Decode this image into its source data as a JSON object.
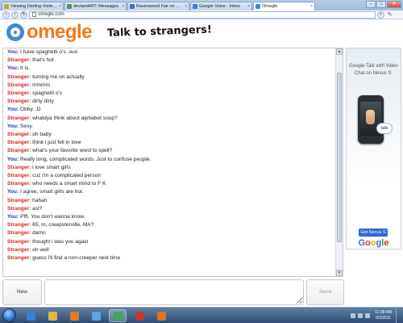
{
  "browser": {
    "tabs": [
      {
        "label": "Viewing Darling Vortexx/...",
        "favicon_color": "#c9a24d",
        "active": false
      },
      {
        "label": "deviantART: Messages",
        "favicon_color": "#5d8f55",
        "active": false
      },
      {
        "label": "Ravenwood Fair on Face...",
        "favicon_color": "#4a6db5",
        "active": false
      },
      {
        "label": "Google Voice - Inbox",
        "favicon_color": "#3a7be0",
        "active": false
      },
      {
        "label": "Omegle",
        "favicon_color": "#3b8ad8",
        "active": true
      }
    ],
    "tab_close_glyph": "×",
    "url": "omegle.com",
    "window_controls": {
      "minimize": "–",
      "maximize": "□",
      "close": "✕"
    }
  },
  "header": {
    "logo_text": "omegle",
    "tagline": "Talk to strangers!"
  },
  "chat": {
    "messages": [
      {
        "sender": "You:",
        "role": "you",
        "text": "I have spaghetti o's. ouo"
      },
      {
        "sender": "Stranger:",
        "role": "stranger",
        "text": "that's hot"
      },
      {
        "sender": "You:",
        "role": "you",
        "text": "It is."
      },
      {
        "sender": "Stranger:",
        "role": "stranger",
        "text": "turning me on actually"
      },
      {
        "sender": "Stranger:",
        "role": "stranger",
        "text": "mmmm"
      },
      {
        "sender": "Stranger:",
        "role": "stranger",
        "text": "spaghetti o's"
      },
      {
        "sender": "Stranger:",
        "role": "stranger",
        "text": "dirty dirty"
      },
      {
        "sender": "You:",
        "role": "you",
        "text": "Obby. ;D"
      },
      {
        "sender": "Stranger:",
        "role": "stranger",
        "text": "whatdya think about alphabet soup?"
      },
      {
        "sender": "You:",
        "role": "you",
        "text": "Sexy."
      },
      {
        "sender": "Stranger:",
        "role": "stranger",
        "text": "oh baby"
      },
      {
        "sender": "Stranger:",
        "role": "stranger",
        "text": "think i just fell in love"
      },
      {
        "sender": "Stranger:",
        "role": "stranger",
        "text": "what's your favorite word to spell?"
      },
      {
        "sender": "You:",
        "role": "you",
        "text": "Really long, complicated words. Just to confuse people."
      },
      {
        "sender": "Stranger:",
        "role": "stranger",
        "text": "i love smart girls"
      },
      {
        "sender": "Stranger:",
        "role": "stranger",
        "text": "cuz i'm a complicated person"
      },
      {
        "sender": "Stranger:",
        "role": "stranger",
        "text": "who needs a smart mind to F    K"
      },
      {
        "sender": "You:",
        "role": "you",
        "text": "I agree, smart girls are hot."
      },
      {
        "sender": "Stranger:",
        "role": "stranger",
        "text": "hahah"
      },
      {
        "sender": "Stranger:",
        "role": "stranger",
        "text": "asl?"
      },
      {
        "sender": "You:",
        "role": "you",
        "text": "Pfft. You don't wanna know."
      },
      {
        "sender": "Stranger:",
        "role": "stranger",
        "text": "65, m, creepsterville, MA?"
      },
      {
        "sender": "Stranger:",
        "role": "stranger",
        "text": "damn"
      },
      {
        "sender": "Stranger:",
        "role": "stranger",
        "text": "thought i was you again"
      },
      {
        "sender": "Stranger:",
        "role": "stranger",
        "text": "oh well"
      },
      {
        "sender": "Stranger:",
        "role": "stranger",
        "text": "guess i'll find a non-creeper next time"
      }
    ],
    "scroll_up_glyph": "▲",
    "scroll_down_glyph": "▼"
  },
  "ad": {
    "text": "Google Talk with Video Chat on Nexus S.",
    "bubble_text": "talk",
    "button_label": "Get Nexus S",
    "brand_letters": [
      "G",
      "o",
      "o",
      "g",
      "l",
      "e"
    ]
  },
  "controls": {
    "new_label": "New",
    "send_label": "Send",
    "message_value": ""
  },
  "taskbar": {
    "clock_time": "11:38 AM",
    "clock_date": "6/3/2011",
    "pinned": [
      {
        "name": "ie-icon",
        "color": "#3a7fd1",
        "active": false
      },
      {
        "name": "explorer-icon",
        "color": "#e2b640",
        "active": false
      },
      {
        "name": "media-player-icon",
        "color": "#e07b1f",
        "active": false
      },
      {
        "name": "messenger-icon",
        "color": "#5fa3e0",
        "active": false
      },
      {
        "name": "chrome-icon",
        "color": "#3ca65a",
        "active": true
      },
      {
        "name": "app-icon",
        "color": "#c23a2b",
        "active": false
      },
      {
        "name": "firefox-icon",
        "color": "#e0731f",
        "active": false
      }
    ]
  }
}
